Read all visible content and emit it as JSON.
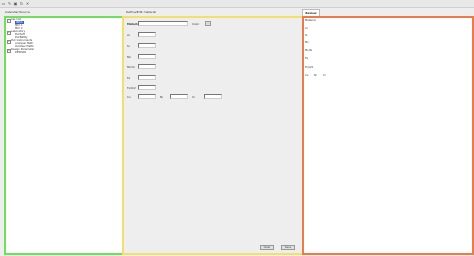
{
  "toolbar": {
    "icons": [
      "open-icon",
      "edit-icon",
      "save-icon",
      "refresh-icon",
      "close-icon"
    ]
  },
  "left_panel": {
    "title": "Calendar/Source",
    "tree": [
      {
        "label": "Cal-Inst",
        "level": 0,
        "toggle": "−"
      },
      {
        "label": "ISP/A",
        "level": 1,
        "selected": true
      },
      {
        "label": "Mtrl 1",
        "level": 1
      },
      {
        "label": "Mtrl 2",
        "level": 1
      },
      {
        "label": "Laboratory",
        "level": 0,
        "toggle": "+"
      },
      {
        "label": "PLCSoft",
        "level": 1
      },
      {
        "label": "PLCBatRy",
        "level": 1
      },
      {
        "label": "PLC Instruments",
        "level": 0,
        "toggle": "+"
      },
      {
        "label": "Analyser Bath",
        "level": 1
      },
      {
        "label": "Oxidiser Plattn",
        "level": 1
      },
      {
        "label": "Design Parameter",
        "level": 0,
        "toggle": "+"
      },
      {
        "label": "DESMAR",
        "level": 1
      }
    ]
  },
  "middle_panel": {
    "title": "Define/Edit material",
    "material_label": "Material",
    "color_label": "Color",
    "color_button": "...",
    "fields": [
      "Al",
      "Si",
      "Mn",
      "Mn/Si",
      "Fe",
      "Ti/Al/2"
    ],
    "cu_label": "Cu",
    "ni_label": "Ni",
    "cr_label": "Cr",
    "clear_button": "Clear",
    "save_button": "Save"
  },
  "right_panel": {
    "tab": "Review",
    "material_label": "Material",
    "values": [
      "Al",
      "Si",
      "Mn",
      "Mn/Si",
      "Fe",
      "Ti/Al/2"
    ],
    "cu_label": "Cu",
    "ni_label": "Ni",
    "cr_label": "Cr"
  }
}
